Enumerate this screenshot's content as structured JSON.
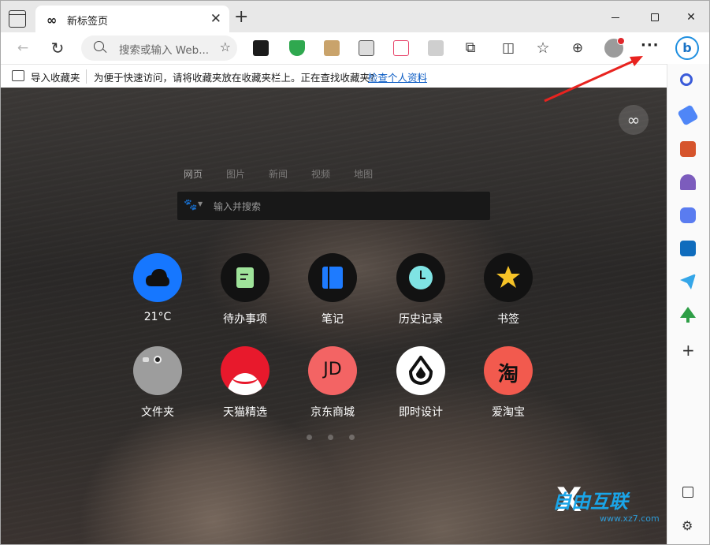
{
  "tab": {
    "icon": "infinity-icon",
    "title": "新标签页",
    "close": "✕"
  },
  "new_tab": "+",
  "window": {
    "close": "✕"
  },
  "toolbar": {
    "back": "←",
    "refresh": "↻",
    "address_placeholder": "搜索或输入 Web...",
    "more": "···",
    "bing": "b"
  },
  "favorites_bar": {
    "import_label": "导入收藏夹",
    "info": "为便于快速访问，请将收藏夹放在收藏夹栏上。正在查找收藏夹?",
    "link": "检查个人资料"
  },
  "newtab": {
    "infinity": "∞",
    "search_tabs": [
      "网页",
      "图片",
      "新闻",
      "视频",
      "地图"
    ],
    "search_placeholder": "输入并搜索",
    "shortcuts_row1": [
      {
        "label": "21°C",
        "color": "#1677ff",
        "icon": "cloud-icon"
      },
      {
        "label": "待办事项",
        "color": "#121212",
        "icon": "note-icon"
      },
      {
        "label": "笔记",
        "color": "#121212",
        "icon": "notebook-icon"
      },
      {
        "label": "历史记录",
        "color": "#121212",
        "icon": "clock-icon"
      },
      {
        "label": "书签",
        "color": "#121212",
        "icon": "star-icon"
      }
    ],
    "shortcuts_row2": [
      {
        "label": "文件夹",
        "color": "#9d9d9d",
        "icon": "folder-icon"
      },
      {
        "label": "天猫精选",
        "color": "#e8192c",
        "icon": "tmall-icon"
      },
      {
        "label": "京东商城",
        "color": "#f36464",
        "icon": "jd-icon",
        "glyph": "JD"
      },
      {
        "label": "即时设计",
        "color": "#ffffff",
        "icon": "jsdesign-icon"
      },
      {
        "label": "爱淘宝",
        "color": "#f25a4e",
        "icon": "taobao-icon",
        "glyph": "淘"
      }
    ]
  },
  "watermark": {
    "brand": "自由互联",
    "site": "www.xz7.com"
  }
}
